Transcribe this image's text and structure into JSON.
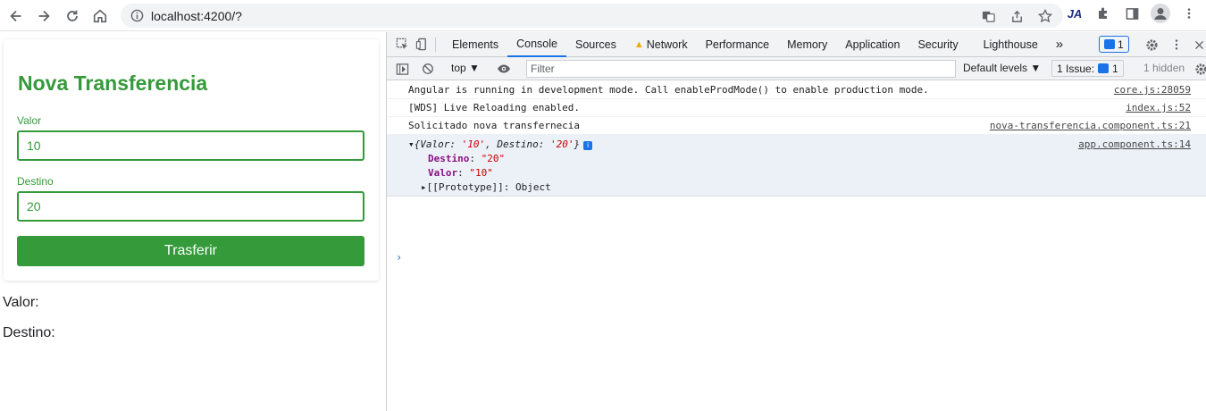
{
  "browser": {
    "url": "localhost:4200/?",
    "extension_label": "JA"
  },
  "page": {
    "title": "Nova Transferencia",
    "valor_label": "Valor",
    "valor_value": "10",
    "destino_label": "Destino",
    "destino_value": "20",
    "submit_label": "Trasferir",
    "output_valor": "Valor:",
    "output_destino": "Destino:"
  },
  "devtools": {
    "tabs": [
      "Elements",
      "Console",
      "Sources",
      "Network",
      "Performance",
      "Memory",
      "Application",
      "Security",
      "Lighthouse"
    ],
    "more_tabs": "»",
    "message_count": "1",
    "context": "top",
    "filter_placeholder": "Filter",
    "levels_label": "Default levels",
    "issues_label": "1 Issue:",
    "issues_count": "1",
    "hidden_label": "1 hidden",
    "logs": [
      {
        "text": "Angular is running in development mode. Call enableProdMode() to enable production mode.",
        "source": "core.js:28059"
      },
      {
        "text": "[WDS] Live Reloading enabled.",
        "source": "index.js:52"
      },
      {
        "text": "Solicitado nova transfernecia",
        "source": "nova-transferencia.component.ts:21"
      }
    ],
    "object_log": {
      "summary_open": "{",
      "summary_k1": "Valor",
      "summary_v1": "'10'",
      "summary_k2": "Destino",
      "summary_v2": "'20'",
      "summary_close": "}",
      "source": "app.component.ts:14",
      "prop1_key": "Destino",
      "prop1_val": "\"20\"",
      "prop2_key": "Valor",
      "prop2_val": "\"10\"",
      "proto": "[[Prototype]]: Object"
    },
    "prompt": "›"
  },
  "colors": {
    "accent_green": "#349a3a",
    "devtools_blue": "#1a73e8"
  }
}
